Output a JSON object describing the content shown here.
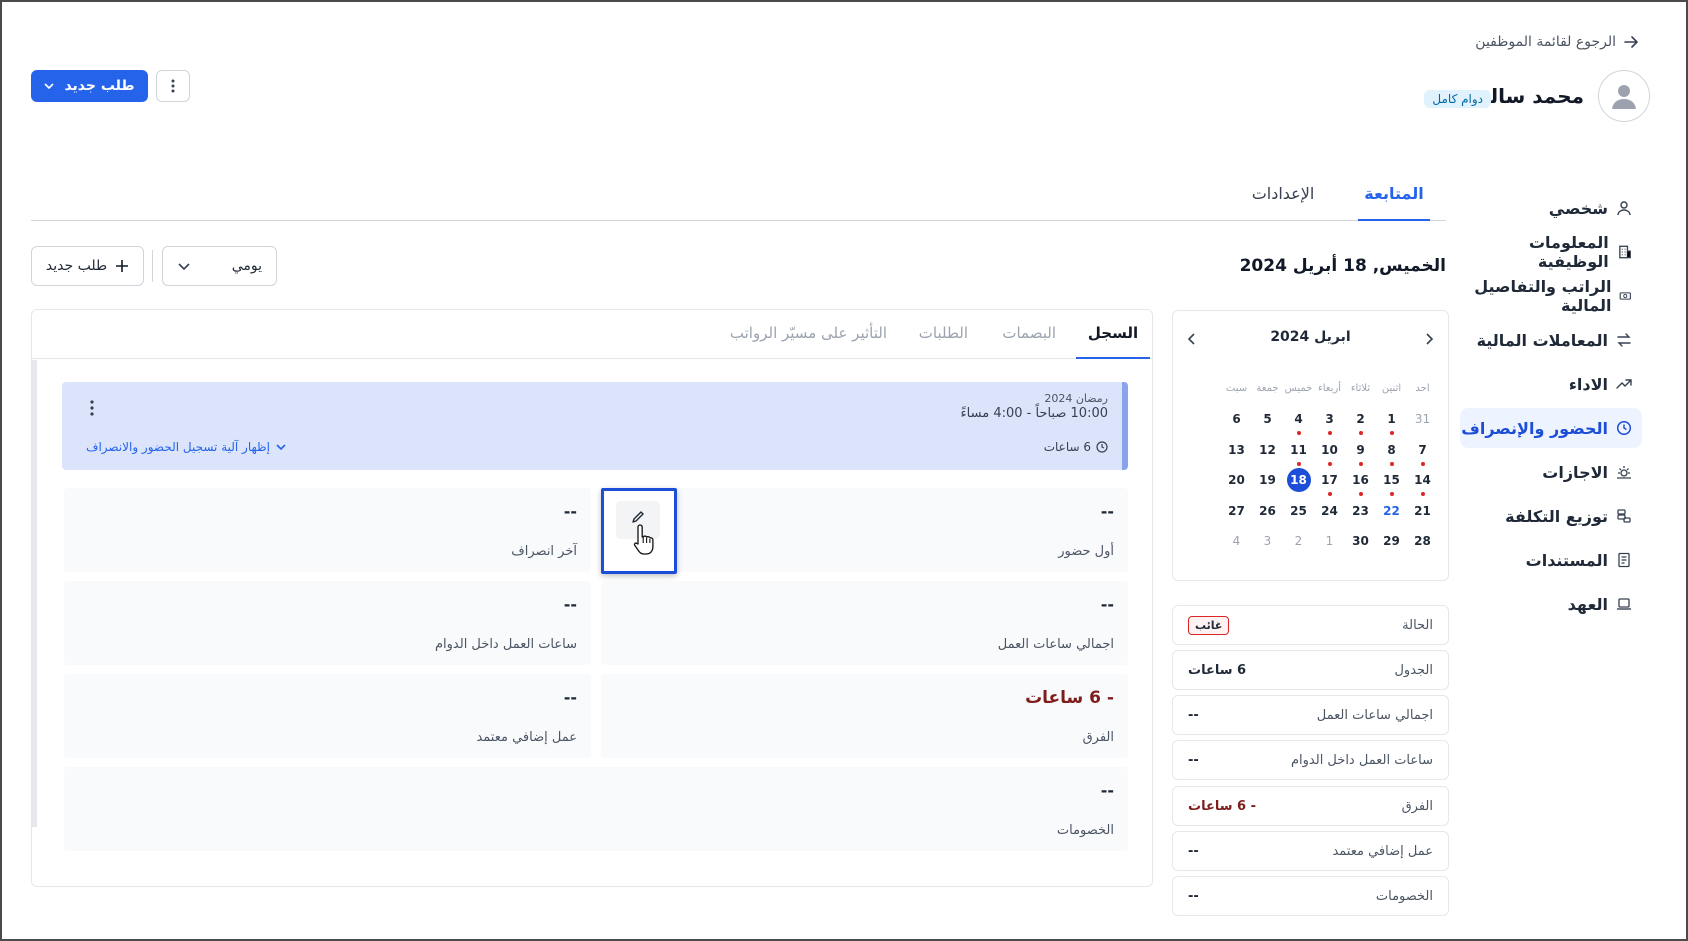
{
  "header": {
    "back_link": "الرجوع لقائمة الموظفين",
    "employee_name": "محمد سالم",
    "employment_badge": "دوام كامل",
    "new_request": "طلب جديد"
  },
  "sidebar": {
    "items": [
      {
        "label": "شخصي",
        "icon": "user-icon"
      },
      {
        "label": "المعلومات الوظيفية",
        "icon": "building-icon"
      },
      {
        "label": "الراتب والتفاصيل المالية",
        "icon": "banknote-icon"
      },
      {
        "label": "المعاملات المالية",
        "icon": "transfer-icon"
      },
      {
        "label": "الاداء",
        "icon": "trend-icon"
      },
      {
        "label": "الحضور والإنصراف",
        "icon": "clock-icon",
        "active": true
      },
      {
        "label": "الاجازات",
        "icon": "sun-icon"
      },
      {
        "label": "توزيع التكلفة",
        "icon": "coins-icon"
      },
      {
        "label": "المستندات",
        "icon": "document-icon"
      },
      {
        "label": "العهد",
        "icon": "laptop-icon"
      }
    ]
  },
  "main_tabs": [
    {
      "label": "المتابعة",
      "active": true
    },
    {
      "label": "الإعدادات",
      "active": false
    }
  ],
  "toolbar": {
    "date_title": "الخميس, 18 أبريل 2024",
    "view_select": "يومي",
    "new_request": "طلب جديد"
  },
  "calendar": {
    "month_label": "ابريل 2024",
    "weekdays": [
      "احد",
      "اثنين",
      "ثلاثاء",
      "أربعاء",
      "خميس",
      "جمعة",
      "سبت"
    ],
    "weeks": [
      [
        {
          "d": "31",
          "m": true
        },
        {
          "d": "1",
          "dot": true
        },
        {
          "d": "2",
          "dot": true
        },
        {
          "d": "3",
          "dot": true
        },
        {
          "d": "4",
          "dot": true
        },
        {
          "d": "5"
        },
        {
          "d": "6"
        }
      ],
      [
        {
          "d": "7",
          "dot": true
        },
        {
          "d": "8",
          "dot": true
        },
        {
          "d": "9",
          "dot": true
        },
        {
          "d": "10",
          "dot": true
        },
        {
          "d": "11",
          "dot": true
        },
        {
          "d": "12"
        },
        {
          "d": "13"
        }
      ],
      [
        {
          "d": "14",
          "dot": true
        },
        {
          "d": "15",
          "dot": true
        },
        {
          "d": "16",
          "dot": true
        },
        {
          "d": "17",
          "dot": true
        },
        {
          "d": "18",
          "today": true
        },
        {
          "d": "19"
        },
        {
          "d": "20"
        }
      ],
      [
        {
          "d": "21"
        },
        {
          "d": "22",
          "blue": true
        },
        {
          "d": "23"
        },
        {
          "d": "24"
        },
        {
          "d": "25"
        },
        {
          "d": "26"
        },
        {
          "d": "27"
        }
      ],
      [
        {
          "d": "28"
        },
        {
          "d": "29"
        },
        {
          "d": "30"
        },
        {
          "d": "1",
          "m": true
        },
        {
          "d": "2",
          "m": true
        },
        {
          "d": "3",
          "m": true
        },
        {
          "d": "4",
          "m": true
        }
      ]
    ]
  },
  "summary": [
    {
      "label": "الحالة",
      "value": "غائب",
      "badge": true
    },
    {
      "label": "الجدول",
      "value": "6 ساعات"
    },
    {
      "label": "اجمالي ساعات العمل",
      "value": "--"
    },
    {
      "label": "ساعات العمل داخل الدوام",
      "value": "--"
    },
    {
      "label": "الفرق",
      "value": "- 6 ساعات",
      "red": true
    },
    {
      "label": "عمل إضافي معتمد",
      "value": "--"
    },
    {
      "label": "الخصومات",
      "value": "--"
    }
  ],
  "card_tabs": [
    {
      "label": "السجل",
      "active": true
    },
    {
      "label": "البصمات"
    },
    {
      "label": "الطلبات"
    },
    {
      "label": "التأثير على مسيّر الرواتب"
    }
  ],
  "banner": {
    "hijri": "رمضان 2024",
    "time_range": "10:00 صباحاً - 4:00 مساءً",
    "hours": "6 ساعات",
    "show_link": "إظهار آلية تسجيل الحضور والانصراف"
  },
  "metrics": [
    {
      "label": "أول حضور",
      "value": "--"
    },
    {
      "label": "آخر انصراف",
      "value": "--"
    },
    {
      "label": "اجمالي ساعات العمل",
      "value": "--"
    },
    {
      "label": "ساعات العمل داخل الدوام",
      "value": "--"
    },
    {
      "label": "الفرق",
      "value": "- 6 ساعات",
      "red": true
    },
    {
      "label": "عمل إضافي معتمد",
      "value": "--"
    },
    {
      "label": "الخصومات",
      "value": "--"
    }
  ],
  "colors": {
    "accent": "#2563eb",
    "active_bg": "#eef4ff",
    "banner_bg": "#dbe4fb",
    "danger": "#b91c1c"
  }
}
